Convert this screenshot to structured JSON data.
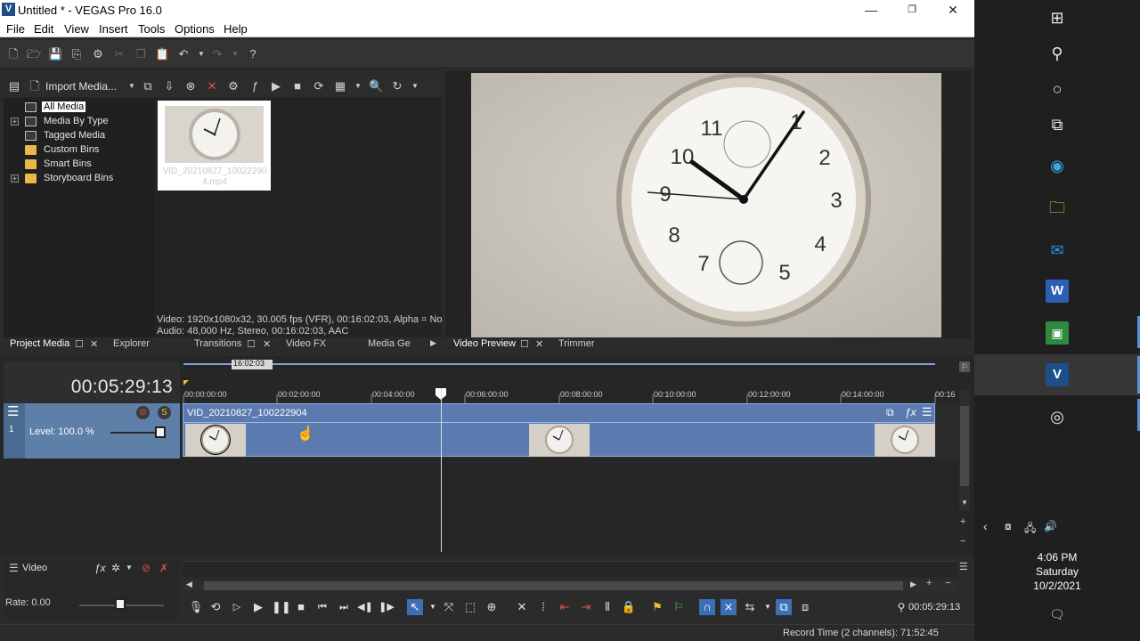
{
  "window": {
    "icon_letter": "V",
    "title": "Untitled * - VEGAS Pro 16.0",
    "minimize": "—",
    "maximize": "❐",
    "close": "✕"
  },
  "menu": [
    "File",
    "Edit",
    "View",
    "Insert",
    "Tools",
    "Options",
    "Help"
  ],
  "media": {
    "import_label": "Import Media...",
    "tree": [
      "All Media",
      "Media By Type",
      "Tagged Media",
      "Custom Bins",
      "Smart Bins",
      "Storyboard Bins"
    ],
    "selected_tree_item": "All Media",
    "thumbnail_name": "VID_20210827_100222904.mp4",
    "info_video": "Video: 1920x1080x32, 30.005 fps (VFR), 00:16:02:03, Alpha = No",
    "info_audio": "Audio: 48,000 Hz, Stereo, 00:16:02:03, AAC"
  },
  "tabs_left": [
    "Project Media",
    "Explorer",
    "Transitions",
    "Video FX",
    "Media Ge"
  ],
  "tabs_right": [
    "Video Preview",
    "Trimmer"
  ],
  "timeline": {
    "current_time": "00:05:29:13",
    "loop_marker": "16:02:03",
    "ruler_labels": [
      "00:00:00:00",
      "00:02:00:00",
      "00:04:00:00",
      "00:06:00:00",
      "00:08:00:00",
      "00:10:00:00",
      "00:12:00:00",
      "00:14:00:00",
      "00:16"
    ],
    "track_number": "1",
    "track_level": "Level: 100.0 %",
    "clip_name": "VID_20210827_100222904"
  },
  "master": {
    "label": "Video",
    "rate": "Rate: 0.00"
  },
  "transport": {
    "time": "00:05:29:13"
  },
  "status": {
    "record_time": "Record Time (2 channels): 71:52:45"
  },
  "clock": {
    "time": "4:06 PM",
    "day": "Saturday",
    "date": "10/2/2021"
  },
  "colors": {
    "clip": "#5a7ab0",
    "track_header": "#5d7fa8",
    "taskbar": "#1f1f1f"
  }
}
